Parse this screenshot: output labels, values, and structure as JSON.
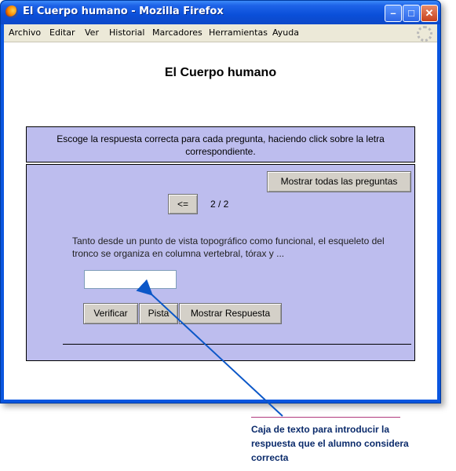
{
  "window": {
    "title": "El Cuerpo humano - Mozilla Firefox",
    "controls": {
      "minimize": "–",
      "maximize": "□",
      "close": "✕"
    }
  },
  "menubar": {
    "items": [
      "Archivo",
      "Editar",
      "Ver",
      "Historial",
      "Marcadores",
      "Herramientas",
      "Ayuda"
    ]
  },
  "page": {
    "title": "El Cuerpo humano",
    "instructions": "Escoge la respuesta correcta para cada pregunta, haciendo click sobre la letra correspondiente.",
    "show_all_button": "Mostrar todas las preguntas",
    "prev_button": "<=",
    "counter": "2 / 2",
    "question": "Tanto desde un punto de vista topográfico como funcional, el esqueleto del tronco se organiza en columna vertebral, tórax y ...",
    "answer_value": "",
    "buttons": {
      "check": "Verificar",
      "hint": "Pista",
      "show_answer": "Mostrar Respuesta"
    }
  },
  "annotation": {
    "caption": "Caja de texto para introducir la respuesta que el alumno considera correcta",
    "color": "#0b2b6b"
  }
}
